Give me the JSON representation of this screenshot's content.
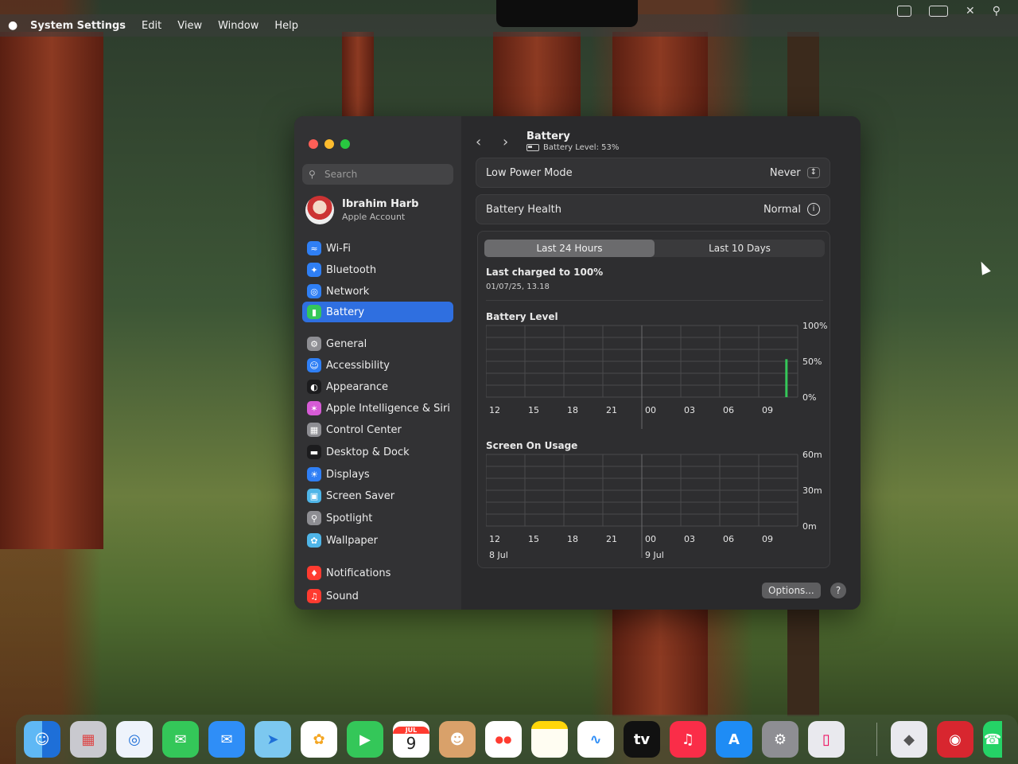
{
  "menubar": {
    "app": "System Settings",
    "items": [
      "Edit",
      "View",
      "Window",
      "Help"
    ]
  },
  "sidebar": {
    "search_placeholder": "Search",
    "account_name": "Ibrahim Harb",
    "account_sub": "Apple Account",
    "items": [
      {
        "label": "Wi-Fi",
        "icon": "wifi-icon",
        "color": "#2f7ff5"
      },
      {
        "label": "Bluetooth",
        "icon": "bluetooth-icon",
        "color": "#2f7ff5"
      },
      {
        "label": "Network",
        "icon": "globe-icon",
        "color": "#2f7ff5"
      },
      {
        "label": "Battery",
        "icon": "battery-icon",
        "color": "#35c759",
        "selected": true
      },
      {
        "label": "General",
        "icon": "gear-icon",
        "color": "#8e8e93"
      },
      {
        "label": "Accessibility",
        "icon": "accessibility-icon",
        "color": "#2f7ff5"
      },
      {
        "label": "Appearance",
        "icon": "appearance-icon",
        "color": "#1c1c1e"
      },
      {
        "label": "Apple Intelligence & Siri",
        "icon": "siri-icon",
        "color": "#d65bd6"
      },
      {
        "label": "Control Center",
        "icon": "control-center-icon",
        "color": "#8e8e93"
      },
      {
        "label": "Desktop & Dock",
        "icon": "dock-icon",
        "color": "#1c1c1e"
      },
      {
        "label": "Displays",
        "icon": "sun-icon",
        "color": "#2f7ff5"
      },
      {
        "label": "Screen Saver",
        "icon": "screen-saver-icon",
        "color": "#4fb5e8"
      },
      {
        "label": "Spotlight",
        "icon": "search-icon",
        "color": "#8e8e93"
      },
      {
        "label": "Wallpaper",
        "icon": "wallpaper-icon",
        "color": "#4fb5e8"
      },
      {
        "label": "Notifications",
        "icon": "bell-icon",
        "color": "#ff3b30"
      },
      {
        "label": "Sound",
        "icon": "speaker-icon",
        "color": "#ff3b30"
      }
    ]
  },
  "header": {
    "title": "Battery",
    "subtitle": "Battery Level: 53%"
  },
  "settings": {
    "low_power_label": "Low Power Mode",
    "low_power_value": "Never",
    "health_label": "Battery Health",
    "health_value": "Normal"
  },
  "history": {
    "tab_24h": "Last 24 Hours",
    "tab_10d": "Last 10 Days",
    "charged_label": "Last charged to 100%",
    "charged_date": "01/07/25, 13.18"
  },
  "chart_data": [
    {
      "type": "bar",
      "title": "Battery Level",
      "categories": [
        "12",
        "15",
        "18",
        "21",
        "00",
        "03",
        "06",
        "09"
      ],
      "y_ticks": [
        "100%",
        "50%",
        "0%"
      ],
      "ylim": [
        0,
        100
      ],
      "values": [
        {
          "x": "09",
          "value": 53
        }
      ],
      "color": "#35c759"
    },
    {
      "type": "bar",
      "title": "Screen On Usage",
      "categories": [
        "12",
        "15",
        "18",
        "21",
        "00",
        "03",
        "06",
        "09"
      ],
      "date_labels": [
        {
          "x": "12",
          "label": "8 Jul"
        },
        {
          "x": "00",
          "label": "9 Jul"
        }
      ],
      "y_ticks": [
        "60m",
        "30m",
        "0m"
      ],
      "ylim": [
        0,
        60
      ],
      "values": []
    }
  ],
  "footer": {
    "options_label": "Options...",
    "help_label": "?"
  },
  "dock": {
    "calendar_month": "JUL",
    "calendar_day": "9",
    "tv_label": "tv"
  }
}
